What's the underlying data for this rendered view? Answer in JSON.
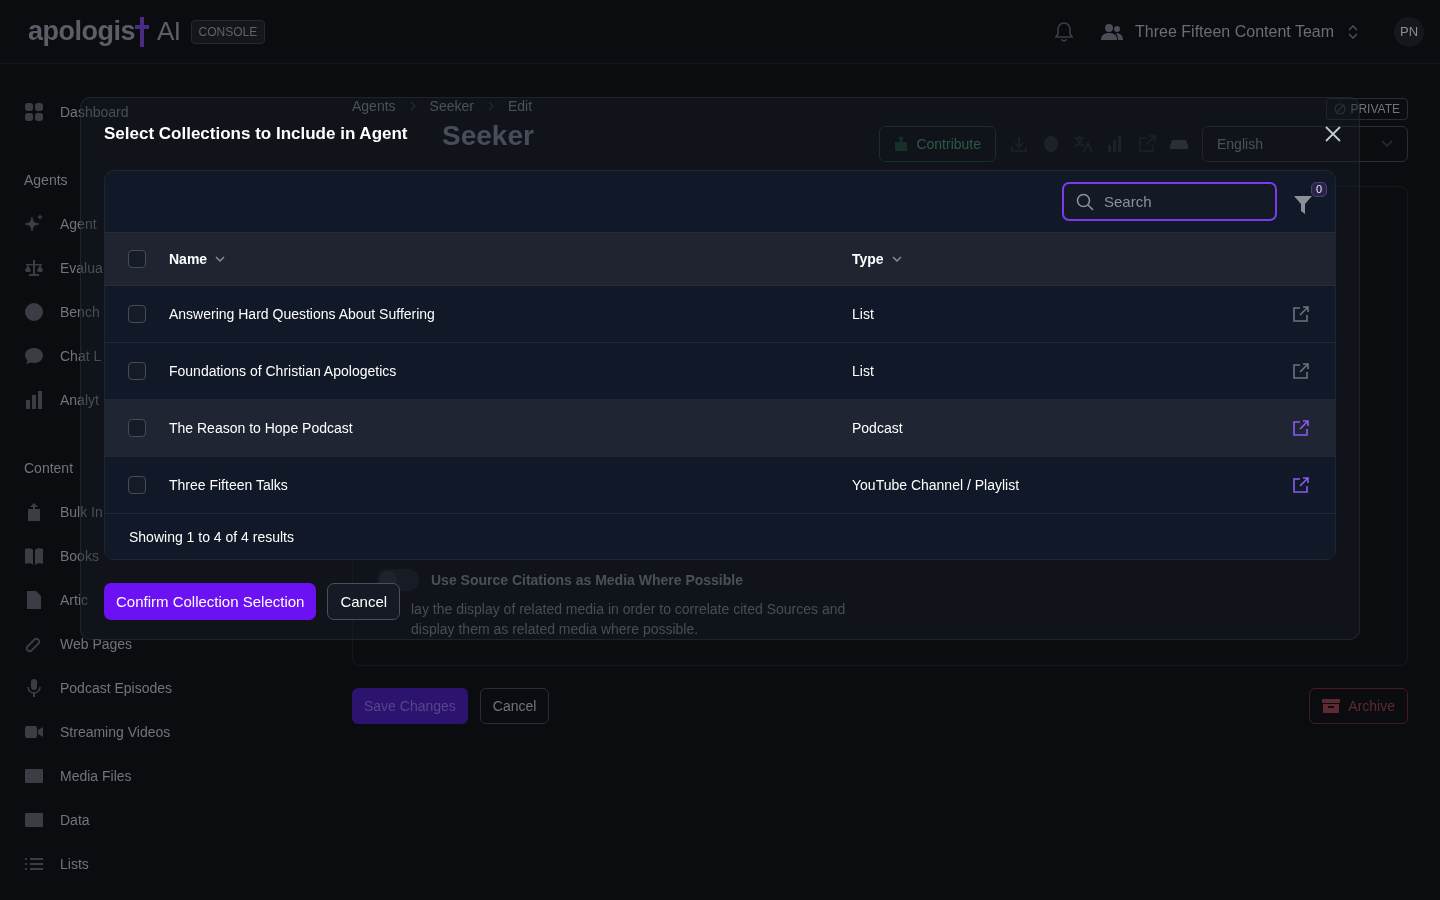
{
  "topbar": {
    "logo_text": "apologis",
    "logo_suffix": "AI",
    "badge": "CONSOLE",
    "team": "Three Fifteen Content Team",
    "avatar": "PN"
  },
  "sidebar": {
    "top_item": "Dashboard",
    "sections": [
      {
        "title": "Agents",
        "items": [
          "Agent",
          "Evalua",
          "Bench",
          "Chat L",
          "Analyt"
        ]
      },
      {
        "title": "Content",
        "items": [
          "Bulk In",
          "Books",
          "Artic",
          "Web Pages",
          "Podcast Episodes",
          "Streaming Videos",
          "Media Files",
          "Data",
          "Lists"
        ]
      }
    ]
  },
  "page": {
    "breadcrumb": [
      "Agents",
      "Seeker",
      "Edit"
    ],
    "title": "Seeker",
    "visibility": "PRIVATE",
    "contribute": "Contribute",
    "language": "English",
    "setting": {
      "label": "Use Source Citations as Media Where Possible",
      "on": false,
      "description": "lay the display of related media in order to correlate cited Sources and display them as related media where possible."
    },
    "buttons": {
      "save": "Save Changes",
      "cancel": "Cancel",
      "archive": "Archive"
    }
  },
  "modal": {
    "title": "Select Collections to Include in Agent",
    "search": {
      "placeholder": "Search",
      "focused": true
    },
    "filter_count": "0",
    "select_all": {
      "checked": false
    },
    "columns": [
      {
        "label": "Name"
      },
      {
        "label": "Type"
      }
    ],
    "rows": [
      {
        "name": "Answering Hard Questions About Suffering",
        "type": "List",
        "checked": false,
        "highlighted": false,
        "link_active": false
      },
      {
        "name": "Foundations of Christian Apologetics",
        "type": "List",
        "checked": false,
        "highlighted": false,
        "link_active": false
      },
      {
        "name": "The Reason to Hope Podcast",
        "type": "Podcast",
        "checked": false,
        "highlighted": true,
        "link_active": true
      },
      {
        "name": "Three Fifteen Talks",
        "type": "YouTube Channel / Playlist",
        "checked": false,
        "highlighted": false,
        "link_active": true
      }
    ],
    "footer": "Showing 1 to 4 of 4 results",
    "buttons": {
      "confirm": "Confirm Collection Selection",
      "cancel": "Cancel"
    }
  }
}
